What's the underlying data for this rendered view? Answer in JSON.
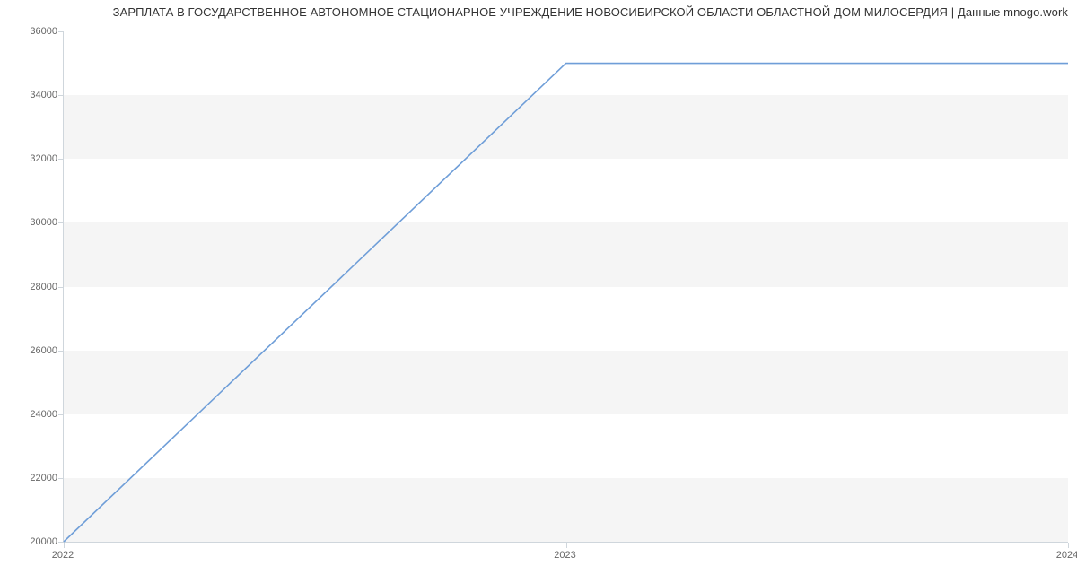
{
  "chart_data": {
    "type": "line",
    "title": "ЗАРПЛАТА В ГОСУДАРСТВЕННОЕ АВТОНОМНОЕ СТАЦИОНАРНОЕ УЧРЕЖДЕНИЕ НОВОСИБИРСКОЙ ОБЛАСТИ ОБЛАСТНОЙ ДОМ МИЛОСЕРДИЯ | Данные mnogo.work",
    "xlabel": "",
    "ylabel": "",
    "xlim": [
      2022,
      2024
    ],
    "ylim": [
      20000,
      36000
    ],
    "x_ticks": [
      2022,
      2023,
      2024
    ],
    "y_ticks": [
      20000,
      22000,
      24000,
      26000,
      28000,
      30000,
      32000,
      34000,
      36000
    ],
    "x": [
      2022,
      2023,
      2024
    ],
    "values": [
      20000,
      35000,
      35000
    ],
    "line_color": "#6f9ed8",
    "band_color": "#f5f5f5",
    "grid": true
  }
}
